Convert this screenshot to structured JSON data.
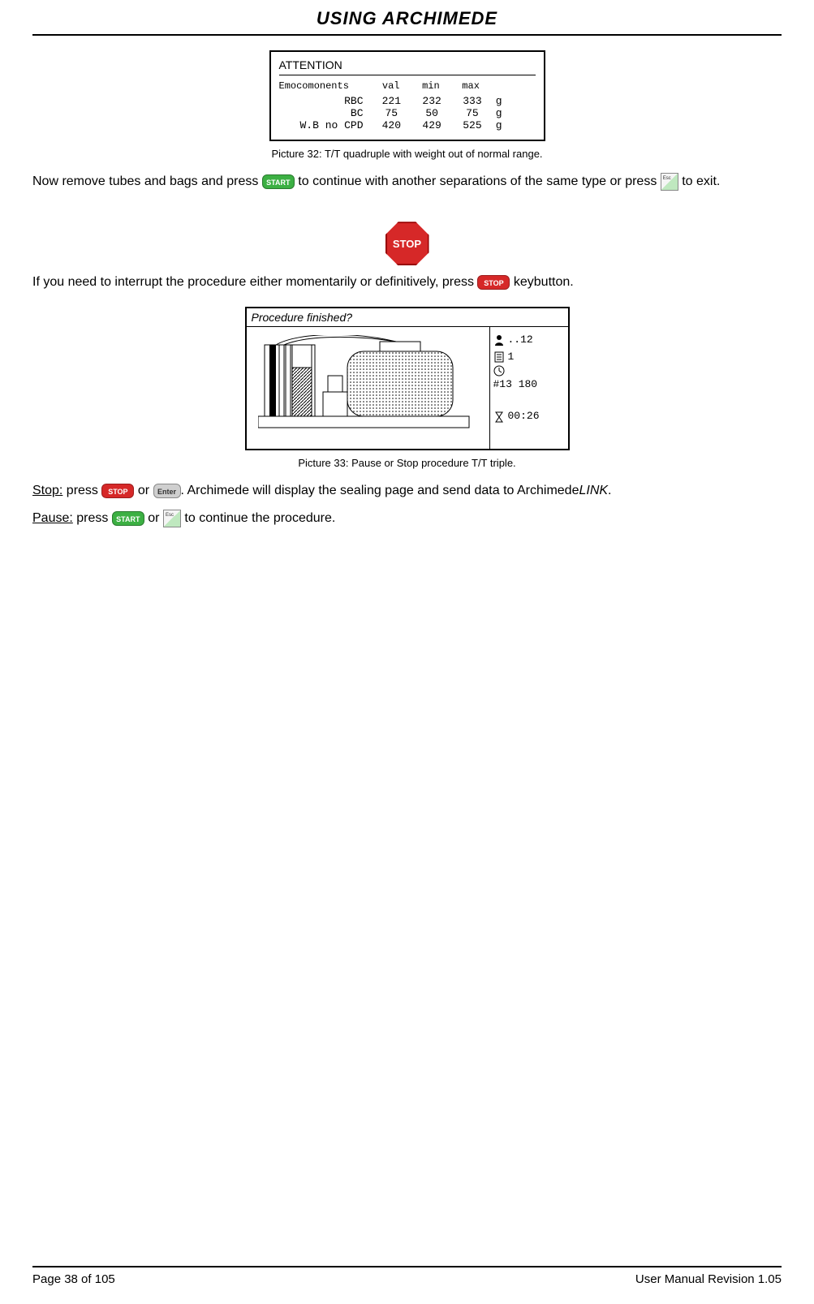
{
  "header": {
    "title": "USING ARCHIMEDE"
  },
  "attention_panel": {
    "title": "ATTENTION",
    "subtitle": "Emocomonents",
    "cols": [
      "val",
      "min",
      "max"
    ],
    "rows": [
      {
        "label": "RBC",
        "val": "221",
        "min": "232",
        "max": "333",
        "unit": "g"
      },
      {
        "label": "BC",
        "val": "75",
        "min": "50",
        "max": "75",
        "unit": "g"
      },
      {
        "label": "W.B no CPD",
        "val": "420",
        "min": "429",
        "max": "525",
        "unit": "g"
      }
    ]
  },
  "captions": {
    "pic32": "Picture 32: T/T quadruple with weight out of normal range.",
    "pic33": "Picture 33: Pause or Stop procedure T/T triple."
  },
  "para1": {
    "a": "Now remove tubes and bags and press ",
    "b": " to continue with another separations of the same type or press ",
    "c": " to exit."
  },
  "buttons": {
    "start": "START",
    "stop": "STOP",
    "enter": "Enter",
    "bigstop": "STOP"
  },
  "para2": {
    "a": "If you need to interrupt the procedure either momentarily or definitively, press ",
    "b": " keybutton."
  },
  "proc_panel": {
    "title": "Procedure finished?",
    "right": {
      "person": "..12",
      "doc": "1",
      "hash": "#13 180",
      "time": "00:26"
    }
  },
  "stop_line": {
    "label": "Stop:",
    "a": " press ",
    "b": " or ",
    "c": ". Archimede will display the sealing page and send data to Archimede",
    "link": "LINK",
    "d": "."
  },
  "pause_line": {
    "label": "Pause:",
    "a": " press ",
    "b": " or ",
    "c": " to continue the procedure."
  },
  "footer": {
    "left": "Page 38 of 105",
    "right": "User Manual Revision 1.05"
  }
}
